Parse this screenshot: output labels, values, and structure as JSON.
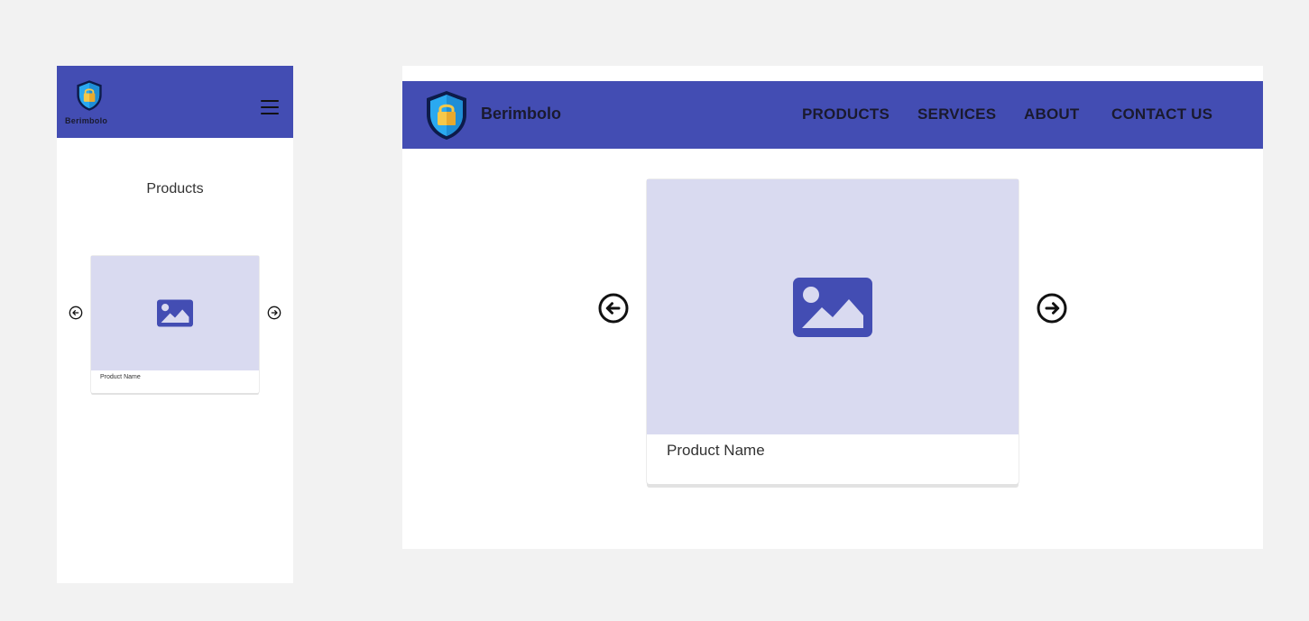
{
  "brand": {
    "name": "Berimbolo",
    "logo_icon": "shield-lock-icon"
  },
  "colors": {
    "header": "#434db3",
    "card_image_bg": "#d9daf0",
    "image_icon": "#434db3",
    "page_bg": "#f2f2f2"
  },
  "mobile": {
    "menu_icon": "hamburger-menu-icon",
    "section_title": "Products",
    "carousel": {
      "prev_icon": "arrow-left-circle-icon",
      "next_icon": "arrow-right-circle-icon",
      "card": {
        "image_icon": "image-placeholder-icon",
        "name": "Product Name"
      }
    }
  },
  "desktop": {
    "nav": [
      {
        "label": "PRODUCTS"
      },
      {
        "label": "SERVICES"
      },
      {
        "label": "ABOUT"
      },
      {
        "label": "CONTACT US"
      }
    ],
    "carousel": {
      "prev_icon": "arrow-left-circle-icon",
      "next_icon": "arrow-right-circle-icon",
      "card": {
        "image_icon": "image-placeholder-icon",
        "name": "Product Name"
      }
    }
  }
}
